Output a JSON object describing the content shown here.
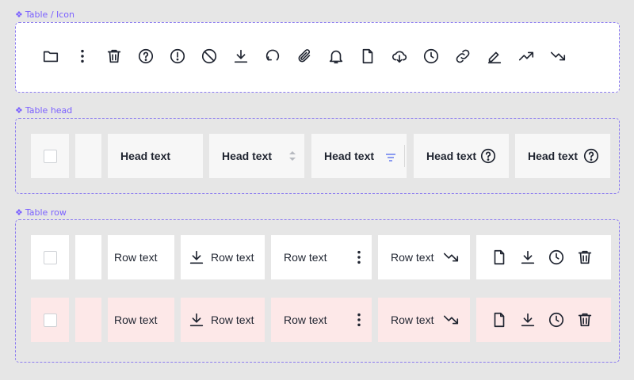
{
  "sections": {
    "icon_label": "Table / Icon",
    "head_label": "Table head",
    "row_label": "Table row"
  },
  "icons": [
    "folder-icon",
    "more-vertical-icon",
    "trash-icon",
    "help-circle-icon",
    "alert-circle-icon",
    "block-icon",
    "download-icon",
    "refresh-icon",
    "paperclip-icon",
    "bell-icon",
    "file-icon",
    "cloud-download-icon",
    "clock-icon",
    "link-icon",
    "edit-icon",
    "trending-up-icon",
    "trending-down-icon"
  ],
  "head": {
    "cells": [
      {
        "label": "Head text"
      },
      {
        "label": "Head text",
        "icon": "sort-icon"
      },
      {
        "label": "Head text",
        "icon": "filter-icon"
      },
      {
        "label": "Head text",
        "icon": "help-circle-icon"
      },
      {
        "label": "Head text",
        "icon": "help-circle-icon"
      }
    ]
  },
  "rows": [
    {
      "state": "default",
      "cells": [
        "Row text",
        "Row text",
        "Row text",
        "Row text"
      ],
      "actions": [
        "file-icon",
        "download-icon",
        "clock-icon",
        "trash-icon"
      ]
    },
    {
      "state": "error",
      "cells": [
        "Row text",
        "Row text",
        "Row text",
        "Row text"
      ],
      "actions": [
        "file-icon",
        "download-icon",
        "clock-icon",
        "trash-icon"
      ]
    }
  ],
  "colors": {
    "accent": "#7b61ff",
    "row_default": "#ffffff",
    "row_error": "#fde8e8",
    "head_bg": "#f7f7f7",
    "page_bg": "#e6e6e6"
  }
}
